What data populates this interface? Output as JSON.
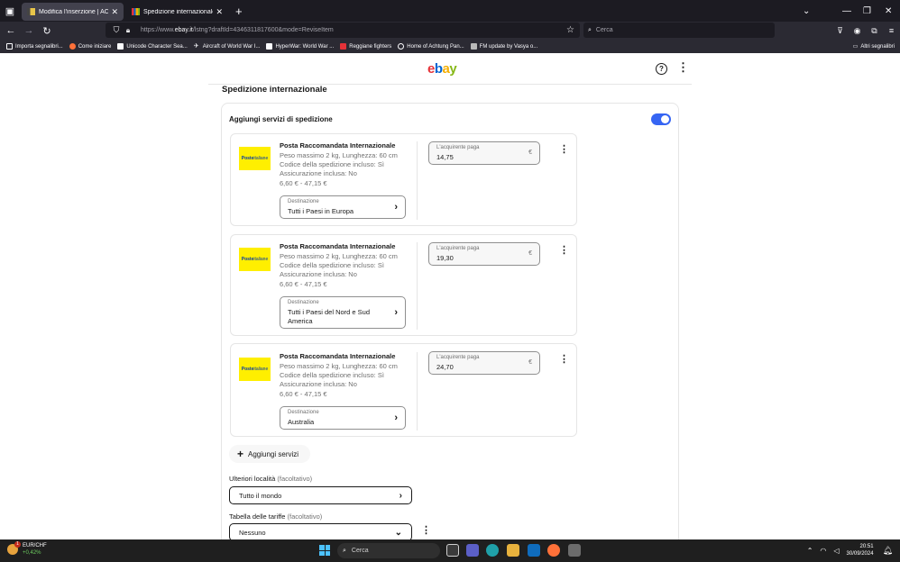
{
  "browser": {
    "tabs": [
      {
        "title": "Modifica l'inserzione | ACADEM",
        "active": true
      },
      {
        "title": "Spedizione internazionale, diffi",
        "active": false
      }
    ],
    "url_prefix": "https://www.",
    "url_domain": "ebay.it",
    "url_rest": "/lstng?draftId=4346311817600&mode=ReviseItem",
    "search_placeholder": "Cerca",
    "bookmarks": [
      "Importa segnalibri...",
      "Come iniziare",
      "Unicode Character Sea...",
      "Aircraft of World War I...",
      "HyperWar: World War ...",
      "Reggiane fighters",
      "Home of Achtung Pan...",
      "FM update by Vasya o..."
    ],
    "other_bookmarks": "Altri segnalibri"
  },
  "page": {
    "logo": [
      "e",
      "b",
      "a",
      "y"
    ],
    "section_title": "Spedizione internazionale",
    "panel_title": "Aggiungi servizi di spedizione",
    "services": [
      {
        "logo_text": "Poste",
        "logo_text2": "italiane",
        "name": "Posta Raccomandata Internazionale",
        "line1": "Peso massimo 2 kg, Lunghezza: 60 cm",
        "line2": "Codice della spedizione incluso: Sì",
        "line3": "Assicurazione inclusa: No",
        "line4": "6,60 € - 47,15 €",
        "dest_label": "Destinazione",
        "dest_value": "Tutti i Paesi in Europa",
        "pay_label": "L'acquirente paga",
        "pay_value": "14,75",
        "currency": "€"
      },
      {
        "logo_text": "Poste",
        "logo_text2": "italiane",
        "name": "Posta Raccomandata Internazionale",
        "line1": "Peso massimo 2 kg, Lunghezza: 60 cm",
        "line2": "Codice della spedizione incluso: Sì",
        "line3": "Assicurazione inclusa: No",
        "line4": "6,60 € - 47,15 €",
        "dest_label": "Destinazione",
        "dest_value": "Tutti i Paesi del Nord e Sud America",
        "pay_label": "L'acquirente paga",
        "pay_value": "19,30",
        "currency": "€"
      },
      {
        "logo_text": "Poste",
        "logo_text2": "italiane",
        "name": "Posta Raccomandata Internazionale",
        "line1": "Peso massimo 2 kg, Lunghezza: 60 cm",
        "line2": "Codice della spedizione incluso: Sì",
        "line3": "Assicurazione inclusa: No",
        "line4": "6,60 € - 47,15 €",
        "dest_label": "Destinazione",
        "dest_value": "Australia",
        "pay_label": "L'acquirente paga",
        "pay_value": "24,70",
        "currency": "€"
      }
    ],
    "add_services": "Aggiungi servizi",
    "more_locations_label": "Ulteriori località",
    "more_locations_optional": "(facoltativo)",
    "more_locations_value": "Tutto il mondo",
    "rate_table_label": "Tabella delle tariffe",
    "rate_table_optional": "(facoltativo)",
    "rate_table_value": "Nessuno"
  },
  "taskbar": {
    "widget_title": "EUR/CHF",
    "widget_change": "+0,42%",
    "search_placeholder": "Cerca",
    "time": "20:51",
    "date": "30/09/2024"
  }
}
